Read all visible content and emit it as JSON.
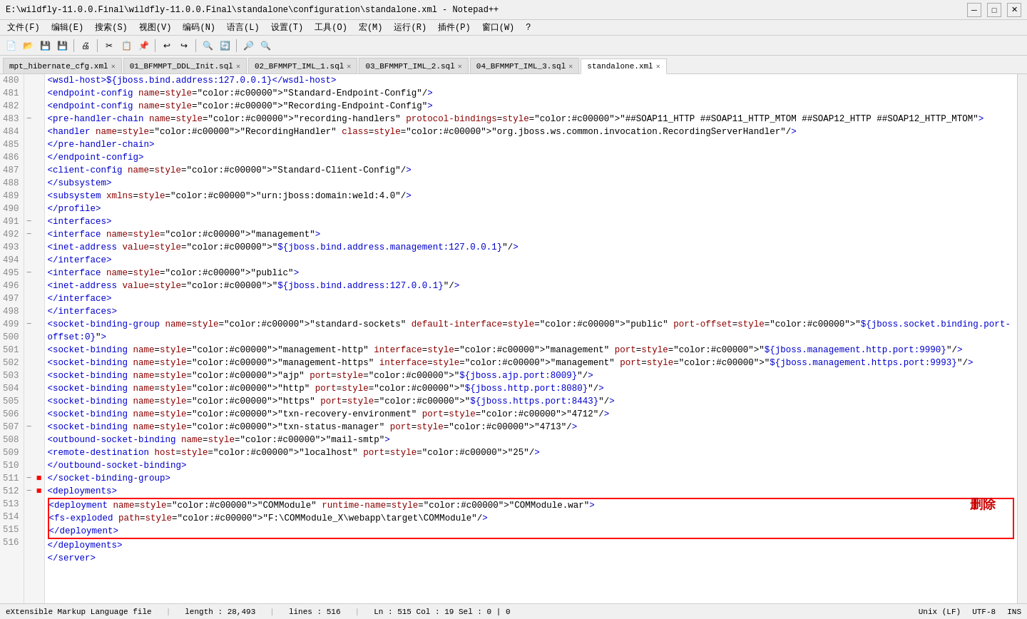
{
  "titleBar": {
    "title": "E:\\wildfly-11.0.0.Final\\wildfly-11.0.0.Final\\standalone\\configuration\\standalone.xml - Notepad++",
    "minBtn": "─",
    "maxBtn": "□",
    "closeBtn": "✕"
  },
  "menuBar": {
    "items": [
      "文件(F)",
      "编辑(E)",
      "搜索(S)",
      "视图(V)",
      "编码(N)",
      "语言(L)",
      "设置(T)",
      "工具(O)",
      "宏(M)",
      "运行(R)",
      "插件(P)",
      "窗口(W)",
      "?"
    ]
  },
  "tabs": [
    {
      "label": "mpt_hibernate_cfg.xml",
      "active": false,
      "closable": true
    },
    {
      "label": "01_BFMMPT_DDL_Init.sql",
      "active": false,
      "closable": true
    },
    {
      "label": "02_BFMMPT_IML_1.sql",
      "active": false,
      "closable": true
    },
    {
      "label": "03_BFMMPT_IML_2.sql",
      "active": false,
      "closable": true
    },
    {
      "label": "04_BFMMPT_IML_3.sql",
      "active": false,
      "closable": true
    },
    {
      "label": "standalone.xml",
      "active": true,
      "closable": true
    }
  ],
  "statusBar": {
    "fileType": "eXtensible Markup Language file",
    "length": "length : 28,493",
    "lines": "lines : 516",
    "cursor": "Ln : 515   Col : 19   Sel : 0 | 0",
    "lineEnding": "Unix (LF)",
    "encoding": "UTF-8",
    "mode": "INS"
  },
  "annotation": "删除",
  "lines": [
    {
      "num": 480,
      "fold": "",
      "mark": "",
      "code": "            <wsdl-host>${jboss.bind.address:127.0.0.1}</wsdl-host>"
    },
    {
      "num": 481,
      "fold": "",
      "mark": "",
      "code": "            <endpoint-config name=\"Standard-Endpoint-Config\"/>"
    },
    {
      "num": 482,
      "fold": "",
      "mark": "",
      "code": "            <endpoint-config name=\"Recording-Endpoint-Config\">"
    },
    {
      "num": 483,
      "fold": "−",
      "mark": "",
      "code": "                <pre-handler-chain name=\"recording-handlers\" protocol-bindings=\"##SOAP11_HTTP ##SOAP11_HTTP_MTOM ##SOAP12_HTTP\n##SOAP12_HTTP_MTOM\">"
    },
    {
      "num": 484,
      "fold": "",
      "mark": "",
      "code": "                    <handler name=\"RecordingHandler\" class=\"org.jboss.ws.common.invocation.RecordingServerHandler\"/>"
    },
    {
      "num": 485,
      "fold": "",
      "mark": "",
      "code": "                </pre-handler-chain>"
    },
    {
      "num": 486,
      "fold": "",
      "mark": "",
      "code": "            </endpoint-config>"
    },
    {
      "num": 487,
      "fold": "",
      "mark": "",
      "code": "            <client-config name=\"Standard-Client-Config\"/>"
    },
    {
      "num": 488,
      "fold": "",
      "mark": "",
      "code": "        </subsystem>"
    },
    {
      "num": 489,
      "fold": "",
      "mark": "",
      "code": "        <subsystem xmlns=\"urn:jboss:domain:weld:4.0\"/>"
    },
    {
      "num": 490,
      "fold": "",
      "mark": "",
      "code": "    </profile>"
    },
    {
      "num": 491,
      "fold": "−",
      "mark": "",
      "code": "    <interfaces>"
    },
    {
      "num": 492,
      "fold": "−",
      "mark": "",
      "code": "        <interface name=\"management\">"
    },
    {
      "num": 493,
      "fold": "",
      "mark": "",
      "code": "            <inet-address value=\"${jboss.bind.address.management:127.0.0.1}\"/>"
    },
    {
      "num": 494,
      "fold": "",
      "mark": "",
      "code": "        </interface>"
    },
    {
      "num": 495,
      "fold": "−",
      "mark": "",
      "code": "        <interface name=\"public\">"
    },
    {
      "num": 496,
      "fold": "",
      "mark": "",
      "code": "            <inet-address value=\"${jboss.bind.address:127.0.0.1}\"/>"
    },
    {
      "num": 497,
      "fold": "",
      "mark": "",
      "code": "        </interface>"
    },
    {
      "num": 498,
      "fold": "",
      "mark": "",
      "code": "    </interfaces>"
    },
    {
      "num": 499,
      "fold": "−",
      "mark": "",
      "code": "    <socket-binding-group name=\"standard-sockets\" default-interface=\"public\" port-offset=\"${jboss.socket.binding.port-offset:0}\">"
    },
    {
      "num": 500,
      "fold": "",
      "mark": "",
      "code": "        <socket-binding name=\"management-http\" interface=\"management\" port=\"${jboss.management.http.port:9990}\"/>"
    },
    {
      "num": 501,
      "fold": "",
      "mark": "",
      "code": "        <socket-binding name=\"management-https\" interface=\"management\" port=\"${jboss.management.https.port:9993}\"/>"
    },
    {
      "num": 502,
      "fold": "",
      "mark": "",
      "code": "        <socket-binding name=\"ajp\" port=\"${jboss.ajp.port:8009}\"/>"
    },
    {
      "num": 503,
      "fold": "",
      "mark": "",
      "code": "        <socket-binding name=\"http\" port=\"${jboss.http.port:8080}\"/>"
    },
    {
      "num": 504,
      "fold": "",
      "mark": "",
      "code": "        <socket-binding name=\"https\" port=\"${jboss.https.port:8443}\"/>"
    },
    {
      "num": 505,
      "fold": "",
      "mark": "",
      "code": "        <socket-binding name=\"txn-recovery-environment\" port=\"4712\"/>"
    },
    {
      "num": 506,
      "fold": "",
      "mark": "",
      "code": "        <socket-binding name=\"txn-status-manager\" port=\"4713\"/>"
    },
    {
      "num": 507,
      "fold": "−",
      "mark": "",
      "code": "        <outbound-socket-binding name=\"mail-smtp\">"
    },
    {
      "num": 508,
      "fold": "",
      "mark": "",
      "code": "            <remote-destination host=\"localhost\" port=\"25\"/>"
    },
    {
      "num": 509,
      "fold": "",
      "mark": "",
      "code": "        </outbound-socket-binding>"
    },
    {
      "num": 510,
      "fold": "",
      "mark": "",
      "code": "    </socket-binding-group>"
    },
    {
      "num": 511,
      "fold": "−",
      "mark": "E",
      "code": "    <deployments>"
    },
    {
      "num": 512,
      "fold": "−",
      "mark": "E",
      "code": "        <deployment name=\"COMModule\" runtime-name=\"COMModule.war\">",
      "boxStart": true
    },
    {
      "num": 513,
      "fold": "",
      "mark": "",
      "code": "            <fs-exploded path=\"F:\\COMModule_X\\webapp\\target\\COMModule\"/>",
      "inBox": true
    },
    {
      "num": 514,
      "fold": "",
      "mark": "",
      "code": "        </deployment>",
      "boxEnd": true
    },
    {
      "num": 515,
      "fold": "",
      "mark": "",
      "code": "    </deployments>"
    },
    {
      "num": 516,
      "fold": "",
      "mark": "",
      "code": "</server>"
    }
  ]
}
